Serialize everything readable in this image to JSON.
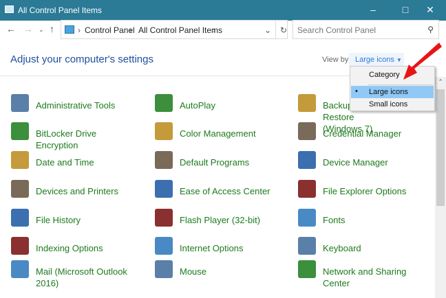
{
  "window": {
    "title": "All Control Panel Items"
  },
  "nav": {
    "breadcrumb": [
      "Control Panel",
      "All Control Panel Items"
    ],
    "search_placeholder": "Search Control Panel"
  },
  "header": {
    "heading": "Adjust your computer's settings",
    "view_by_label": "View by:",
    "view_by_value": "Large icons"
  },
  "view_menu": {
    "options": [
      "Category",
      "Large icons",
      "Small icons"
    ],
    "selected": "Large icons"
  },
  "items": [
    [
      "Administrative Tools",
      "AutoPlay",
      "Backup and Restore (Windows 7)"
    ],
    [
      "BitLocker Drive Encryption",
      "Color Management",
      "Credential Manager"
    ],
    [
      "Date and Time",
      "Default Programs",
      "Device Manager"
    ],
    [
      "Devices and Printers",
      "Ease of Access Center",
      "File Explorer Options"
    ],
    [
      "File History",
      "Flash Player (32-bit)",
      "Fonts"
    ],
    [
      "Indexing Options",
      "Internet Options",
      "Keyboard"
    ],
    [
      "Mail (Microsoft Outlook 2016)",
      "Mouse",
      "Network and Sharing Center"
    ]
  ],
  "colors": {
    "titlebar": "#2b7a96",
    "link": "#1d7a1d",
    "heading": "#1e4fa0",
    "menu_selected": "#90c8f6"
  }
}
